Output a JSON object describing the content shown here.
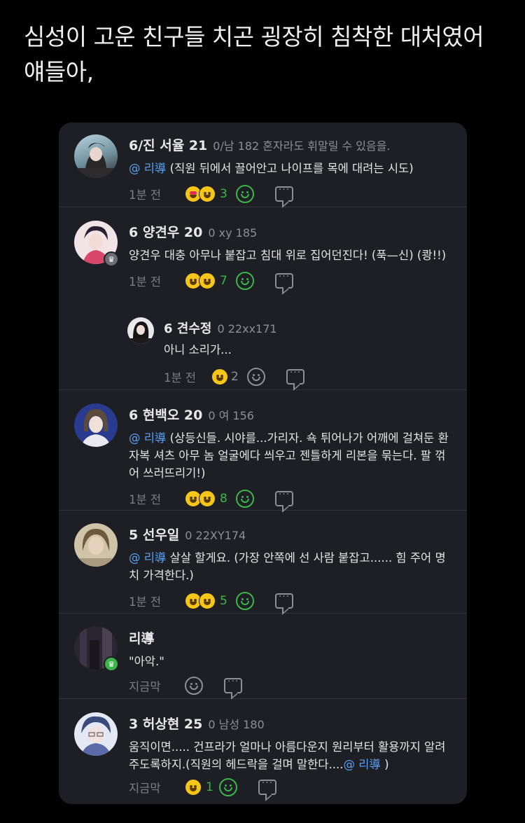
{
  "tweet": {
    "text": "심성이 고운 친구들 치곤 굉장히 침착한 대처였어 얘들아,"
  },
  "comments": [
    {
      "name": "6/진 서율 21",
      "meta": "0/남 182 혼자라도 휘말릴 수 있음을.",
      "mention": "@ 리導",
      "text": " (직원 뒤에서 끌어안고 나이프를 목에 대려는 시도)",
      "time": "1분 전",
      "count": "3"
    },
    {
      "name": "6 양견우 20",
      "meta": "0 xy 185",
      "text": "양견우 대충 아무나 붙잡고 침대 위로 집어던진다! (푹—신) (쾅!!)",
      "time": "1분 전",
      "count": "7"
    },
    {
      "name": "6 견수정",
      "meta": "0 22xx171",
      "text": "아니 소리가...",
      "time": "1분 전",
      "count": "2"
    },
    {
      "name": "6 현백오 20",
      "meta": "0 여 156",
      "mention": "@ 리導",
      "text": " (상등신들. 시야를...가리자. 쇽 튀어나가 어깨에 걸쳐둔 환자복 셔츠 아무 놈 얼굴에다 씌우고 젠틀하게 리본을 묶는다. 팔 꺾어 쓰러뜨리기!)",
      "time": "1분 전",
      "count": "8"
    },
    {
      "name": "5 선우일",
      "meta": "0 22XY174",
      "mention": "@ 리導",
      "text": " 살살 할게요. (가장 안쪽에 선 사람 붙잡고...... 힘 주어 명치 가격한다.)",
      "time": "1분 전",
      "count": "5"
    },
    {
      "name": "리導",
      "meta": "",
      "text": "\"아악.\"",
      "time": "지금막"
    },
    {
      "name": "3 허상현 25",
      "meta": "0 남성 180",
      "text": "움직이면..... 건프라가 얼마나 아름다운지 원리부터 활용까지 알려주도록하지.(직원의 헤드락을 걸며 말한다....",
      "mention_end": "@ 리導",
      "text_end": " )",
      "time": "지금막",
      "count": "1"
    }
  ]
}
